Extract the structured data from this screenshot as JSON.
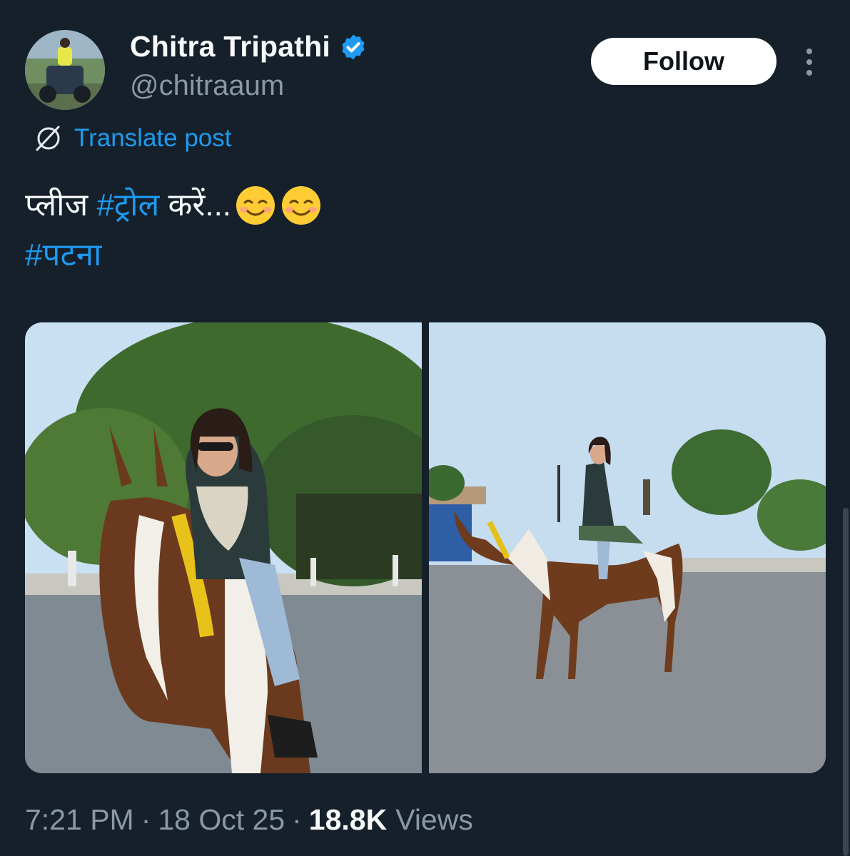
{
  "author": {
    "name": "Chitra Tripathi",
    "handle": "@chitraaum",
    "verified": true
  },
  "actions": {
    "follow_label": "Follow"
  },
  "translate": {
    "label": "Translate post"
  },
  "tweet": {
    "text_prefix": "प्लीज ",
    "hashtag1": "#ट्रोल",
    "text_suffix": " करें...",
    "hashtag2": "#पटना"
  },
  "meta": {
    "time": "7:21 PM",
    "separator": "·",
    "date": "18 Oct 25",
    "views_count": "18.8K",
    "views_label": "Views"
  },
  "colors": {
    "background": "#15202b",
    "accent": "#1d9bf0",
    "secondary_text": "#8b98a5",
    "primary_text": "#f7f9f9"
  },
  "icons": {
    "verified": "verified-badge-icon",
    "translate": "globe-slash-icon",
    "more": "more-vertical-icon",
    "emoji": "smiling-face-icon"
  }
}
